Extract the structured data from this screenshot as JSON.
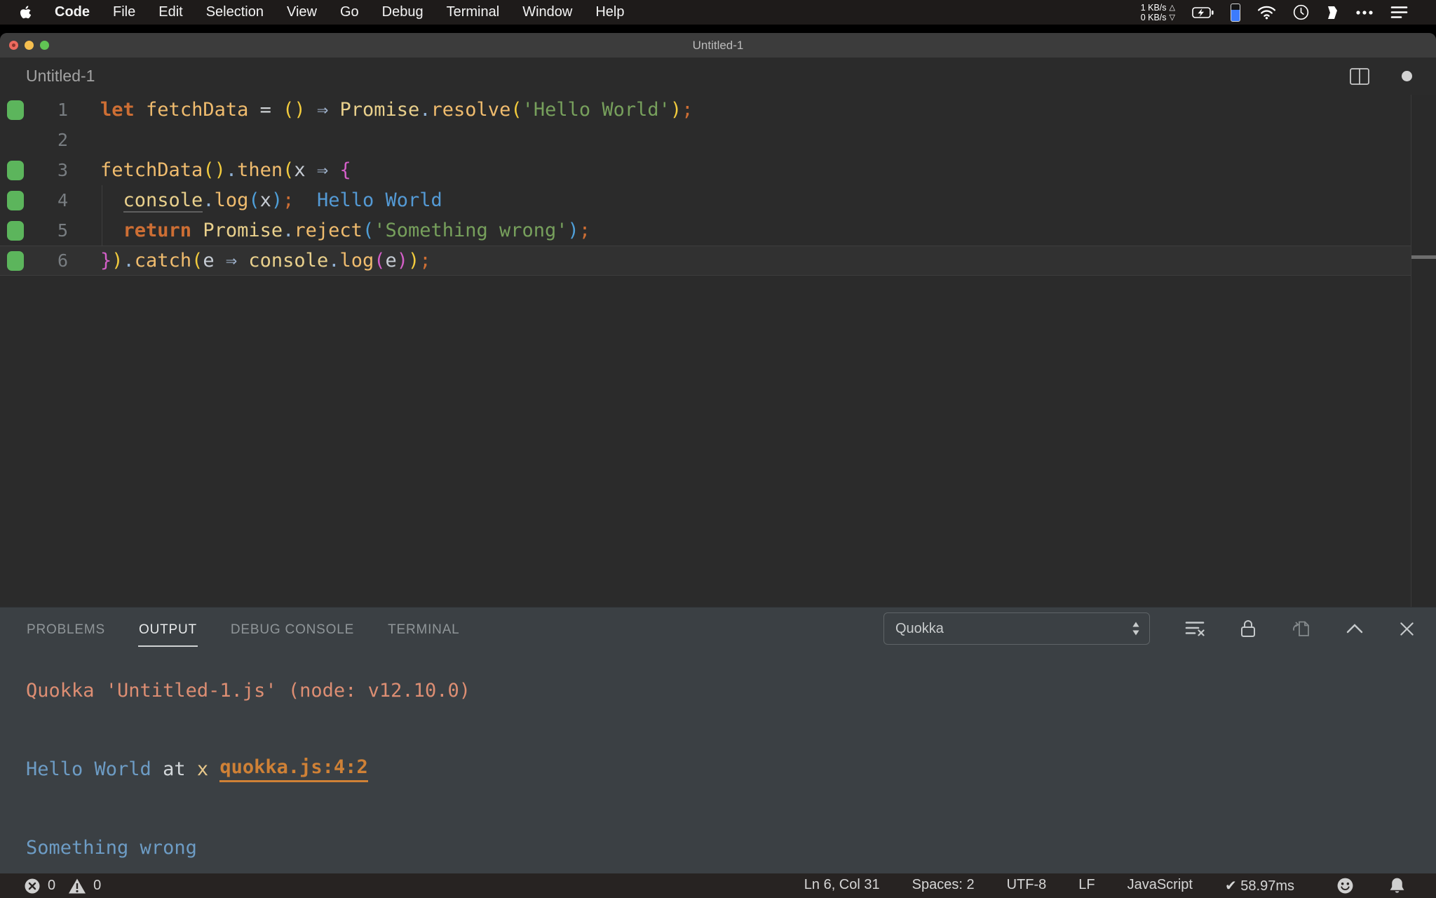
{
  "colors": {
    "keyword": "#cd6e34",
    "func": "#f0bc6e",
    "builtin": "#e9d08c",
    "op": "#cfd3d6",
    "dot": "#8fb0d4",
    "b1": "#f2cb3d",
    "b2": "#d45fc8",
    "b3": "#4f9fd8",
    "arrow": "#9fb2cc",
    "param": "#c6ccd4",
    "string": "#77a05c",
    "semi": "#cd6e34",
    "plain": "#c8c8c8",
    "inline": "#549ad5",
    "out_header": "#dd8e73",
    "out_blue": "#6d9cc5",
    "out_plain": "#d3d7da",
    "out_var": "#e8c88b",
    "out_link": "#cf8136",
    "gutter_green": "#5cb55c",
    "hint_underline": "#5f5f5f"
  },
  "menu_bar": {
    "app_name": "Code",
    "items": [
      "File",
      "Edit",
      "Selection",
      "View",
      "Go",
      "Debug",
      "Terminal",
      "Window",
      "Help"
    ],
    "net_up": "1 KB/s",
    "net_up_arrow": "△",
    "net_down": "0 KB/s",
    "net_down_arrow": "▽",
    "status_icon_names": [
      "network-speed",
      "battery-charging-icon",
      "device-battery-icon",
      "wifi-icon",
      "clock-icon",
      "menu-extra-icon",
      "more-dots-icon",
      "list-menu-icon"
    ]
  },
  "window": {
    "title": "Untitled-1"
  },
  "editor": {
    "tab_label": "Untitled-1",
    "tab_icon_names": [
      "split-editor-icon",
      "unsaved-dot"
    ],
    "lines": [
      {
        "num": "1",
        "covered": true,
        "current": false,
        "tokens": [
          {
            "t": "let",
            "c": "keyword",
            "b": true
          },
          {
            "t": " ",
            "c": "plain"
          },
          {
            "t": "fetchData",
            "c": "func"
          },
          {
            "t": " ",
            "c": "plain"
          },
          {
            "t": "=",
            "c": "op"
          },
          {
            "t": " ",
            "c": "plain"
          },
          {
            "t": "()",
            "c": "b1"
          },
          {
            "t": " ",
            "c": "plain"
          },
          {
            "t": "⇒",
            "c": "arrow"
          },
          {
            "t": " ",
            "c": "plain"
          },
          {
            "t": "Promise",
            "c": "builtin"
          },
          {
            "t": ".",
            "c": "dot"
          },
          {
            "t": "resolve",
            "c": "func"
          },
          {
            "t": "(",
            "c": "b1"
          },
          {
            "t": "'Hello World'",
            "c": "string"
          },
          {
            "t": ")",
            "c": "b1"
          },
          {
            "t": ";",
            "c": "semi"
          }
        ]
      },
      {
        "num": "2",
        "covered": false,
        "current": false,
        "tokens": []
      },
      {
        "num": "3",
        "covered": true,
        "current": false,
        "tokens": [
          {
            "t": "fetchData",
            "c": "func"
          },
          {
            "t": "()",
            "c": "b1"
          },
          {
            "t": ".",
            "c": "dot"
          },
          {
            "t": "then",
            "c": "func"
          },
          {
            "t": "(",
            "c": "b1"
          },
          {
            "t": "x",
            "c": "param"
          },
          {
            "t": " ",
            "c": "plain"
          },
          {
            "t": "⇒",
            "c": "arrow"
          },
          {
            "t": " ",
            "c": "plain"
          },
          {
            "t": "{",
            "c": "b2"
          }
        ]
      },
      {
        "num": "4",
        "covered": true,
        "current": false,
        "tokens": [
          {
            "t": "  ",
            "c": "plain"
          },
          {
            "t": "console",
            "c": "builtin",
            "u": "hint"
          },
          {
            "t": ".",
            "c": "dot"
          },
          {
            "t": "log",
            "c": "func"
          },
          {
            "t": "(",
            "c": "b3"
          },
          {
            "t": "x",
            "c": "param"
          },
          {
            "t": ")",
            "c": "b3"
          },
          {
            "t": ";",
            "c": "semi"
          },
          {
            "t": "  ",
            "c": "plain"
          },
          {
            "t": "Hello World",
            "c": "inline"
          }
        ]
      },
      {
        "num": "5",
        "covered": true,
        "current": false,
        "tokens": [
          {
            "t": "  ",
            "c": "plain"
          },
          {
            "t": "return",
            "c": "keyword",
            "b": true
          },
          {
            "t": " ",
            "c": "plain"
          },
          {
            "t": "Promise",
            "c": "builtin"
          },
          {
            "t": ".",
            "c": "dot"
          },
          {
            "t": "reject",
            "c": "func"
          },
          {
            "t": "(",
            "c": "b3"
          },
          {
            "t": "'Something wrong'",
            "c": "string"
          },
          {
            "t": ")",
            "c": "b3"
          },
          {
            "t": ";",
            "c": "semi"
          }
        ]
      },
      {
        "num": "6",
        "covered": true,
        "current": true,
        "tokens": [
          {
            "t": "}",
            "c": "b2"
          },
          {
            "t": ")",
            "c": "b1"
          },
          {
            "t": ".",
            "c": "dot"
          },
          {
            "t": "catch",
            "c": "func"
          },
          {
            "t": "(",
            "c": "b1"
          },
          {
            "t": "e",
            "c": "param"
          },
          {
            "t": " ",
            "c": "plain"
          },
          {
            "t": "⇒",
            "c": "arrow"
          },
          {
            "t": " ",
            "c": "plain"
          },
          {
            "t": "console",
            "c": "builtin"
          },
          {
            "t": ".",
            "c": "dot"
          },
          {
            "t": "log",
            "c": "func"
          },
          {
            "t": "(",
            "c": "b2"
          },
          {
            "t": "e",
            "c": "param"
          },
          {
            "t": ")",
            "c": "b2"
          },
          {
            "t": ")",
            "c": "b1"
          },
          {
            "t": ";",
            "c": "semi"
          }
        ]
      }
    ]
  },
  "panel": {
    "tabs": [
      {
        "label": "PROBLEMS",
        "active": false
      },
      {
        "label": "OUTPUT",
        "active": true
      },
      {
        "label": "DEBUG CONSOLE",
        "active": false
      },
      {
        "label": "TERMINAL",
        "active": false
      }
    ],
    "channel_select": "Quokka",
    "action_icon_names": [
      "clear-output-icon",
      "lock-scroll-icon",
      "open-in-editor-icon",
      "maximize-panel-icon",
      "close-panel-icon"
    ],
    "output_lines": [
      {
        "tokens": [
          {
            "t": "Quokka 'Untitled-1.js' (node: v12.10.0)",
            "c": "out_header"
          }
        ]
      },
      {
        "tokens": []
      },
      {
        "tokens": [
          {
            "t": "Hello World",
            "c": "out_blue"
          },
          {
            "t": " at ",
            "c": "out_plain"
          },
          {
            "t": "x",
            "c": "out_var"
          },
          {
            "t": " ",
            "c": "out_plain"
          },
          {
            "t": "quokka.js:4:2",
            "c": "out_link",
            "b": true,
            "u": "link",
            "link": true
          }
        ]
      },
      {
        "tokens": []
      },
      {
        "tokens": [
          {
            "t": "Something wrong",
            "c": "out_blue"
          }
        ]
      }
    ]
  },
  "status_bar": {
    "errors": "0",
    "warnings": "0",
    "items": [
      "Ln 6, Col 31",
      "Spaces: 2",
      "UTF-8",
      "LF",
      "JavaScript",
      "✔ 58.97ms"
    ],
    "icon_names": [
      "errors-icon",
      "warnings-icon",
      "feedback-smiley-icon",
      "notifications-bell-icon"
    ]
  }
}
